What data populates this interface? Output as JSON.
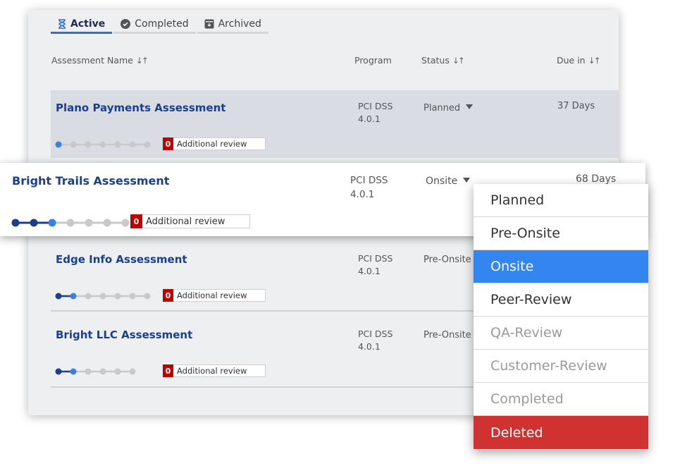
{
  "tabs": [
    {
      "label": "Active",
      "icon": "hourglass-icon"
    },
    {
      "label": "Completed",
      "icon": "check-circle-icon"
    },
    {
      "label": "Archived",
      "icon": "archive-icon"
    }
  ],
  "columns": {
    "name": "Assessment Name",
    "program": "Program",
    "status": "Status",
    "due": "Due in",
    "sort_glyph": "↓↑"
  },
  "rows": [
    {
      "name": "Plano Payments Assessment",
      "program_line1": "PCI DSS",
      "program_line2": "4.0.1",
      "status": "Planned",
      "due": "37 Days",
      "review_count": "0",
      "review_label": "Additional review",
      "steps_done": 1,
      "steps_total": 7
    },
    {
      "name": "Bright Trails Assessment",
      "program_line1": "PCI DSS",
      "program_line2": "4.0.1",
      "status": "Onsite",
      "due": "68 Days",
      "review_count": "0",
      "review_label": "Additional review",
      "steps_done": 3,
      "steps_total": 7
    },
    {
      "name": "Edge Info Assessment",
      "program_line1": "PCI DSS",
      "program_line2": "4.0.1",
      "status": "Pre-Onsite",
      "due": "",
      "review_count": "0",
      "review_label": "Additional review",
      "steps_done": 2,
      "steps_total": 7
    },
    {
      "name": "Bright LLC Assessment",
      "program_line1": "PCI DSS",
      "program_line2": "4.0.1",
      "status": "Pre-Onsite",
      "due": "",
      "review_count": "0",
      "review_label": "Additional review",
      "steps_done": 2,
      "steps_total": 6
    }
  ],
  "status_menu": {
    "options": [
      "Planned",
      "Pre-Onsite",
      "Onsite",
      "Peer-Review",
      "QA-Review",
      "Customer-Review",
      "Completed",
      "Deleted"
    ],
    "selected": "Onsite"
  },
  "colors": {
    "accent": "#2f6fde",
    "step_done": "#1e3d8f",
    "step_current": "#3b82e0",
    "step_todo": "#c9c9c9",
    "danger": "#d03131",
    "selected": "#3385f0"
  }
}
